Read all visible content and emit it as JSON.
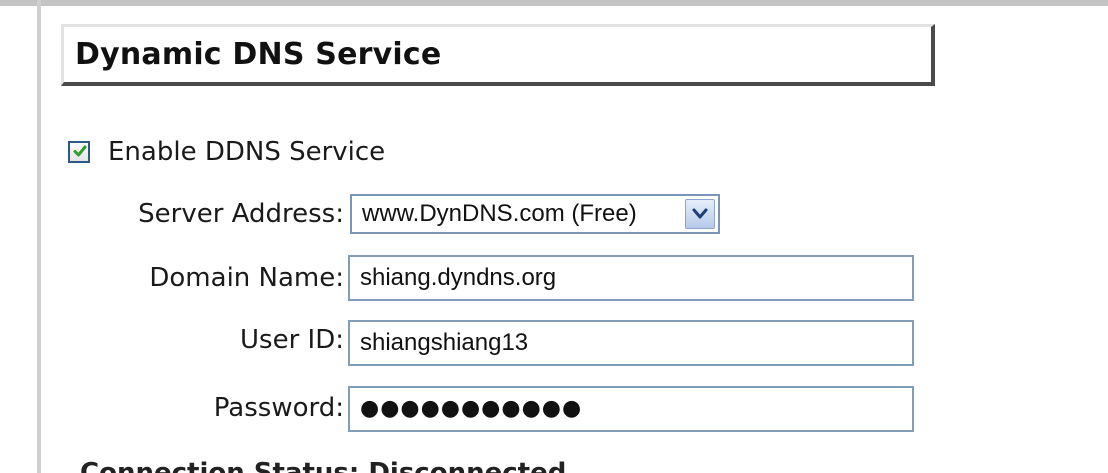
{
  "section": {
    "title": "Dynamic DNS Service"
  },
  "enable": {
    "label": "Enable DDNS Service",
    "checked": true
  },
  "form": {
    "server_address": {
      "label": "Server Address:",
      "value": "www.DynDNS.com (Free)"
    },
    "domain_name": {
      "label": "Domain Name:",
      "value": "shiang.dyndns.org"
    },
    "user_id": {
      "label": "User ID:",
      "value": "shiangshiang13"
    },
    "password": {
      "label": "Password:",
      "masked_value": "●●●●●●●●●●●"
    }
  },
  "partial_row": {
    "text": "Connection Status: Disconnected"
  },
  "colors": {
    "input_border": "#7f9db9",
    "checkbox_border": "#2b5a86",
    "checkmark": "#2e9e2e",
    "dropdown_button": "#b6c9ea"
  },
  "icons": {
    "checkbox": "checkmark-icon",
    "dropdown": "chevron-down-icon"
  }
}
